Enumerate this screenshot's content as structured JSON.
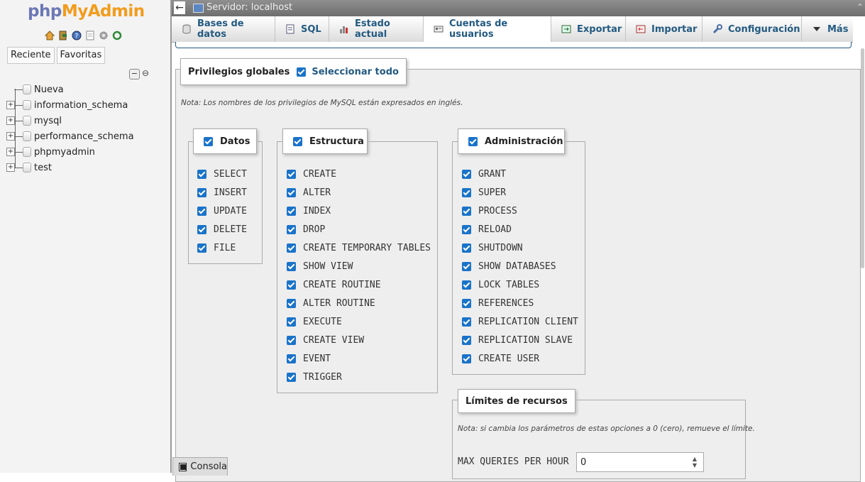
{
  "nav": {
    "logo_part1": "php",
    "logo_part2": "MyAdmin",
    "tabs": [
      "Reciente",
      "Favoritas"
    ],
    "tree": [
      {
        "label": "Nueva"
      },
      {
        "label": "information_schema"
      },
      {
        "label": "mysql"
      },
      {
        "label": "performance_schema"
      },
      {
        "label": "phpmyadmin"
      },
      {
        "label": "test"
      }
    ]
  },
  "topbar": {
    "server_label": "Servidor: localhost"
  },
  "menu": {
    "tabs": [
      {
        "label": "Bases de datos",
        "icon": "database-icon"
      },
      {
        "label": "SQL",
        "icon": "sql-icon"
      },
      {
        "label": "Estado actual",
        "icon": "status-icon"
      },
      {
        "label": "Cuentas de usuarios",
        "icon": "users-icon",
        "active": true
      },
      {
        "label": "Exportar",
        "icon": "export-icon"
      },
      {
        "label": "Importar",
        "icon": "import-icon"
      },
      {
        "label": "Configuración",
        "icon": "wrench-icon"
      },
      {
        "label": "Más",
        "icon": "triangle-down-icon"
      }
    ]
  },
  "global": {
    "title": "Privilegios globales",
    "select_all": "Seleccionar todo",
    "note": "Nota: Los nombres de los privilegios de MySQL están expresados en inglés."
  },
  "groups": {
    "datos": {
      "title": "Datos",
      "items": [
        "SELECT",
        "INSERT",
        "UPDATE",
        "DELETE",
        "FILE"
      ]
    },
    "estructura": {
      "title": "Estructura",
      "items": [
        "CREATE",
        "ALTER",
        "INDEX",
        "DROP",
        "CREATE TEMPORARY TABLES",
        "SHOW VIEW",
        "CREATE ROUTINE",
        "ALTER ROUTINE",
        "EXECUTE",
        "CREATE VIEW",
        "EVENT",
        "TRIGGER"
      ]
    },
    "administracion": {
      "title": "Administración",
      "items": [
        "GRANT",
        "SUPER",
        "PROCESS",
        "RELOAD",
        "SHUTDOWN",
        "SHOW DATABASES",
        "LOCK TABLES",
        "REFERENCES",
        "REPLICATION CLIENT",
        "REPLICATION SLAVE",
        "CREATE USER"
      ]
    }
  },
  "limits": {
    "title": "Límites de recursos",
    "note": "Nota: si cambia los parámetros de estas opciones a 0 (cero), remueve el límite.",
    "max_queries_label": "MAX QUERIES PER HOUR",
    "max_queries_value": "0"
  },
  "console": {
    "label": "Consola"
  }
}
